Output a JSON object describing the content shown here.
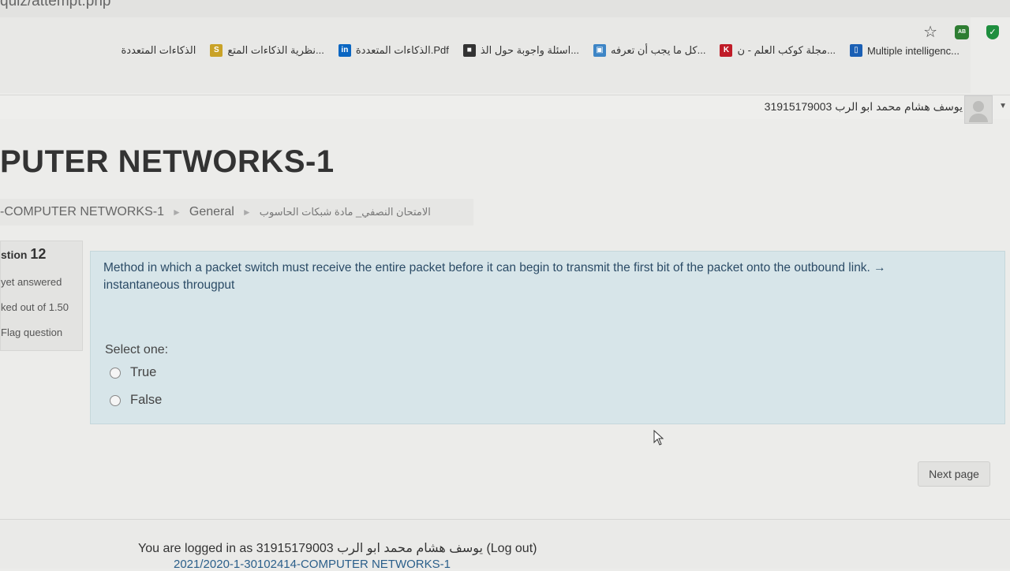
{
  "browser": {
    "url_fragment": "quiz/attempt.php",
    "bookmarks": [
      {
        "label": "Multiple intelligenc...",
        "icon": "document-icon",
        "color": "#1a5fb4",
        "glyph": "▯"
      },
      {
        "label": "مجلة كوكب العلم - ن...",
        "icon": "magazine-icon",
        "color": "#c01c28",
        "glyph": "K"
      },
      {
        "label": "كل ما يجب أن تعرفه...",
        "icon": "page-icon",
        "color": "#3d85c6",
        "glyph": "▣"
      },
      {
        "label": "اسئلة واجوبة حول الذ...",
        "icon": "dark-site-icon",
        "color": "#333333",
        "glyph": "■"
      },
      {
        "label": "الذكاءات المتعددة.Pdf",
        "icon": "linkedin-icon",
        "color": "#0a66c2",
        "glyph": "in"
      },
      {
        "label": "نظرية الذكاءات المتع...",
        "icon": "yellow-site-icon",
        "color": "#c9a227",
        "glyph": "S"
      },
      {
        "label": "الذكاءات المتعددة",
        "icon": "",
        "color": "",
        "glyph": ""
      }
    ],
    "ext_label": "AB"
  },
  "header": {
    "user_name": "يوسف هشام محمد ابو الرب 31915179003"
  },
  "course": {
    "title": "PUTER NETWORKS-1"
  },
  "breadcrumb": {
    "items": [
      "-COMPUTER NETWORKS-1",
      "General",
      "الامتحان النصفي_ مادة شبكات الحاسوب"
    ],
    "separator": "►"
  },
  "question_info": {
    "label": "stion",
    "number": "12",
    "state": "yet answered",
    "marks": "ked out of 1.50",
    "flag": "Flag question"
  },
  "question": {
    "text": "Method in which a packet switch must receive the entire packet before it can begin to transmit the first bit of the packet onto the outbound link. → instantaneous througput",
    "prompt": "Select one:",
    "options": [
      "True",
      "False"
    ]
  },
  "navigation": {
    "next_label": "Next page"
  },
  "footer": {
    "logged_in_prefix": "You are logged in as",
    "user_name": "31915179003 يوسف هشام محمد ابو الرب",
    "logout": "(Log out)",
    "course_line": "2021/2020-1-30102414-COMPUTER NETWORKS-1"
  }
}
